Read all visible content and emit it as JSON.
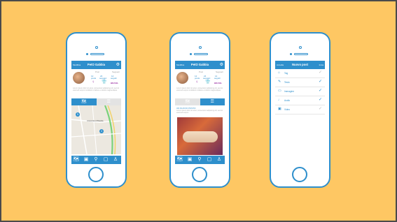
{
  "colors": {
    "background": "#fec763",
    "accent": "#2e8fcc",
    "purple": "#a03ca8"
  },
  "profile": {
    "header_left": "Modifica",
    "title": "PetO Gabbia",
    "settings_icon": "gear-icon",
    "tab_posts": "Post",
    "tab_followers": "Seguaci",
    "stat_posts_num": "12",
    "stat_posts_label": "posts",
    "stat_follow_num": "24",
    "stat_follow_label": "seguaci",
    "stat_seg_num": "14",
    "stat_seg_label": "seguiti",
    "badge_label": "BRASIL",
    "description": "Lorem ipsum dolor sit amet, consectetur adipiscing elit, sed do eiusmod tempor incididunt ut labore et dolore magna aliqua.",
    "map_pin_1": "5",
    "map_pin_2": "3",
    "map_label": "Università di Brasilia",
    "list_icon": "list-icon",
    "map_icon": "map-icon"
  },
  "feed": {
    "post_title": "UN NUOVO POSTO",
    "post_body": "Lorem ipsum dolor sit amet, consectetur adipiscing elit, sed do eiusmod tempor."
  },
  "new_post": {
    "header_left": "Annulla",
    "title": "Nuovo post",
    "header_right": "Invia",
    "rows": [
      {
        "icon": "tag-icon",
        "label": "Tag",
        "checked": false
      },
      {
        "icon": "pencil-icon",
        "label": "Testo",
        "checked": true
      },
      {
        "icon": "image-icon",
        "label": "Immagine",
        "checked": true
      },
      {
        "icon": "microphone-icon",
        "label": "Audio",
        "checked": true
      },
      {
        "icon": "video-icon",
        "label": "Video",
        "checked": false
      }
    ]
  },
  "bottom_nav": [
    "map-nav-icon",
    "card-nav-icon",
    "pin-nav-icon",
    "chat-nav-icon",
    "user-nav-icon"
  ]
}
